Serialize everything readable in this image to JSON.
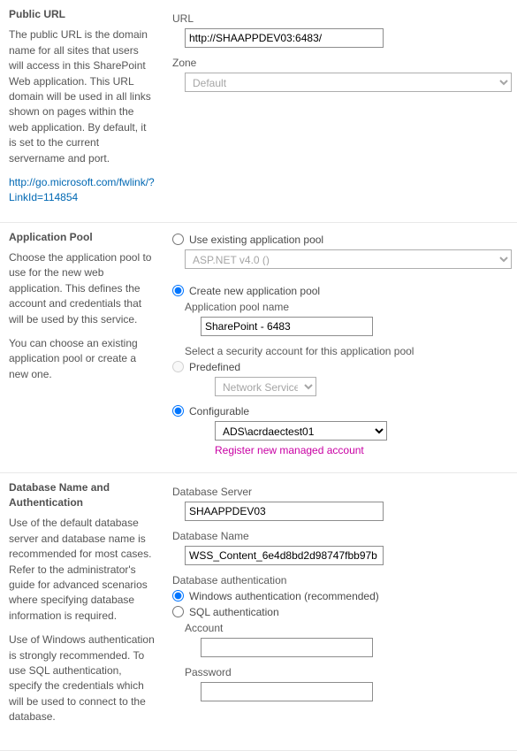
{
  "public_url": {
    "heading": "Public URL",
    "desc": "The public URL is the domain name for all sites that users will access in this SharePoint Web application.  This URL domain will be used in all links shown on pages within the web application.  By default, it is set to the current servername and port.",
    "help_link": "http://go.microsoft.com/fwlink/?LinkId=114854",
    "url_label": "URL",
    "url_value": "http://SHAAPPDEV03:6483/",
    "zone_label": "Zone",
    "zone_value": "Default"
  },
  "app_pool": {
    "heading": "Application Pool",
    "desc1": "Choose the application pool to use for the new web application. This defines the account and credentials that will be used by this service.",
    "desc2": "You can choose an existing application pool or create a new one.",
    "use_existing_label": "Use existing application pool",
    "existing_value": "ASP.NET v4.0 ()",
    "create_new_label": "Create new application pool",
    "pool_name_label": "Application pool name",
    "pool_name_value": "SharePoint - 6483",
    "security_label": "Select a security account for this application pool",
    "predefined_label": "Predefined",
    "predefined_value": "Network Service",
    "configurable_label": "Configurable",
    "configurable_value": "ADS\\acrdaectest01",
    "register_link": "Register new managed account"
  },
  "db": {
    "heading": "Database Name and Authentication",
    "desc1": "Use of the default database server and database name is recommended for most cases. Refer to the administrator's guide for advanced scenarios where specifying database information is required.",
    "desc2": "Use of Windows authentication is strongly recommended. To use SQL authentication, specify the credentials which will be used to connect to the database.",
    "server_label": "Database Server",
    "server_value": "SHAAPPDEV03",
    "name_label": "Database Name",
    "name_value": "WSS_Content_6e4d8bd2d98747fbb97b",
    "auth_label": "Database authentication",
    "win_auth_label": "Windows authentication (recommended)",
    "sql_auth_label": "SQL authentication",
    "account_label": "Account",
    "account_value": "",
    "password_label": "Password",
    "password_value": ""
  }
}
